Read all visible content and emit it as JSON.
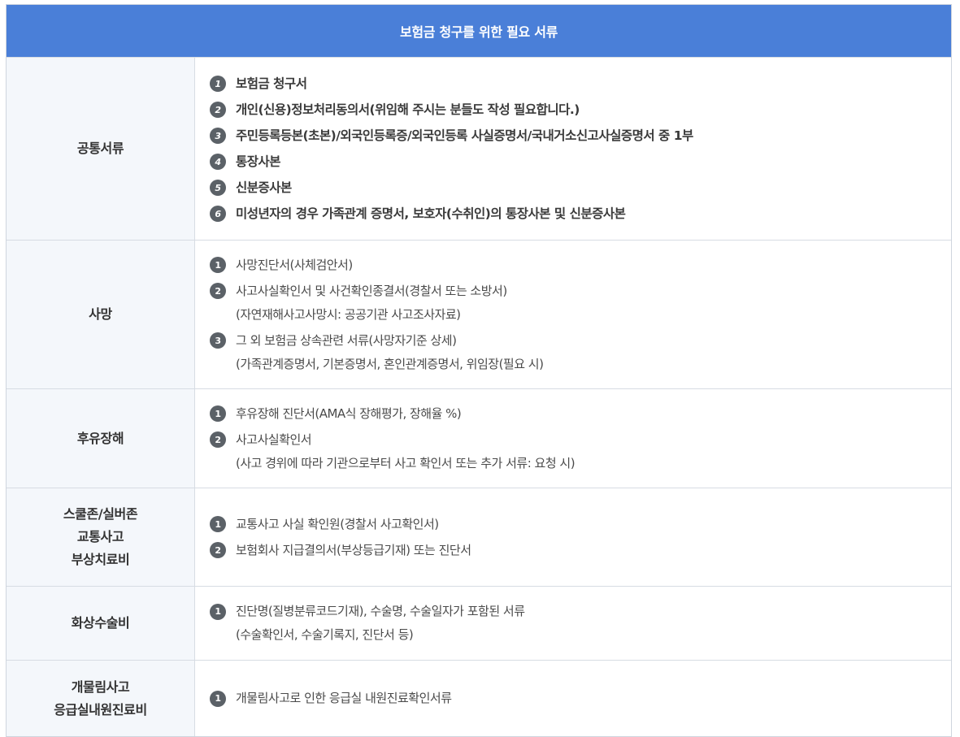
{
  "header": {
    "title": "보험금 청구를 위한 필요 서류"
  },
  "sections": [
    {
      "category": [
        "공통서류"
      ],
      "items": [
        {
          "num": "1",
          "lines": [
            "보험금 청구서"
          ]
        },
        {
          "num": "2",
          "lines": [
            "개인(신용)정보처리동의서(위임해 주시는 분들도 작성 필요합니다.)"
          ]
        },
        {
          "num": "3",
          "lines": [
            "주민등록등본(초본)/외국인등록증/외국인등록 사실증명서/국내거소신고사실증명서 중 1부"
          ]
        },
        {
          "num": "4",
          "lines": [
            "통장사본"
          ]
        },
        {
          "num": "5",
          "lines": [
            "신분증사본"
          ]
        },
        {
          "num": "6",
          "lines": [
            "미성년자의 경우 가족관계 증명서, 보호자(수취인)의 통장사본 및 신분증사본"
          ]
        }
      ]
    },
    {
      "category": [
        "사망"
      ],
      "items": [
        {
          "num": "1",
          "lines": [
            "사망진단서(사체검안서)"
          ]
        },
        {
          "num": "2",
          "lines": [
            "사고사실확인서 및 사건확인종결서(경찰서 또는 소방서)",
            "(자연재해사고사망시: 공공기관 사고조사자료)"
          ]
        },
        {
          "num": "3",
          "lines": [
            "그 외 보험금 상속관련 서류(사망자기준 상세)",
            "(가족관계증명서, 기본증명서, 혼인관계증명서, 위임장(필요 시)"
          ]
        }
      ]
    },
    {
      "category": [
        "후유장해"
      ],
      "items": [
        {
          "num": "1",
          "lines": [
            "후유장해 진단서(AMA식 장해평가, 장해율 %)"
          ]
        },
        {
          "num": "2",
          "lines": [
            "사고사실확인서",
            "(사고 경위에 따라 기관으로부터 사고 확인서 또는 추가 서류: 요청 시)"
          ]
        }
      ]
    },
    {
      "category": [
        "스쿨존/실버존",
        "교통사고",
        "부상치료비"
      ],
      "items": [
        {
          "num": "1",
          "lines": [
            "교통사고 사실 확인원(경찰서 사고확인서)"
          ]
        },
        {
          "num": "2",
          "lines": [
            "보험회사 지급결의서(부상등급기재) 또는 진단서"
          ]
        }
      ]
    },
    {
      "category": [
        "화상수술비"
      ],
      "items": [
        {
          "num": "1",
          "lines": [
            "진단명(질병분류코드기재), 수술명, 수술일자가 포함된 서류",
            "(수술확인서, 수술기록지, 진단서 등)"
          ]
        }
      ]
    },
    {
      "category": [
        "개물림사고",
        "응급실내원진료비"
      ],
      "items": [
        {
          "num": "1",
          "lines": [
            "개물림사고로 인한 응급실 내원진료확인서류"
          ]
        }
      ]
    }
  ]
}
